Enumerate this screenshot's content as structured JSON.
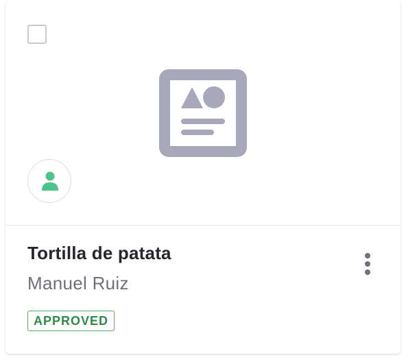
{
  "card": {
    "title": "Tortilla de patata",
    "author": "Manuel Ruiz",
    "status": "APPROVED",
    "selected": false,
    "thumbnail_icon": "image-placeholder-icon",
    "avatar_icon": "user-icon",
    "menu_icon": "more-vertical-icon"
  },
  "colors": {
    "avatar_accent": "#4cc38a",
    "placeholder_icon": "#a8a8bd",
    "status_approved": "#2e8b47"
  }
}
